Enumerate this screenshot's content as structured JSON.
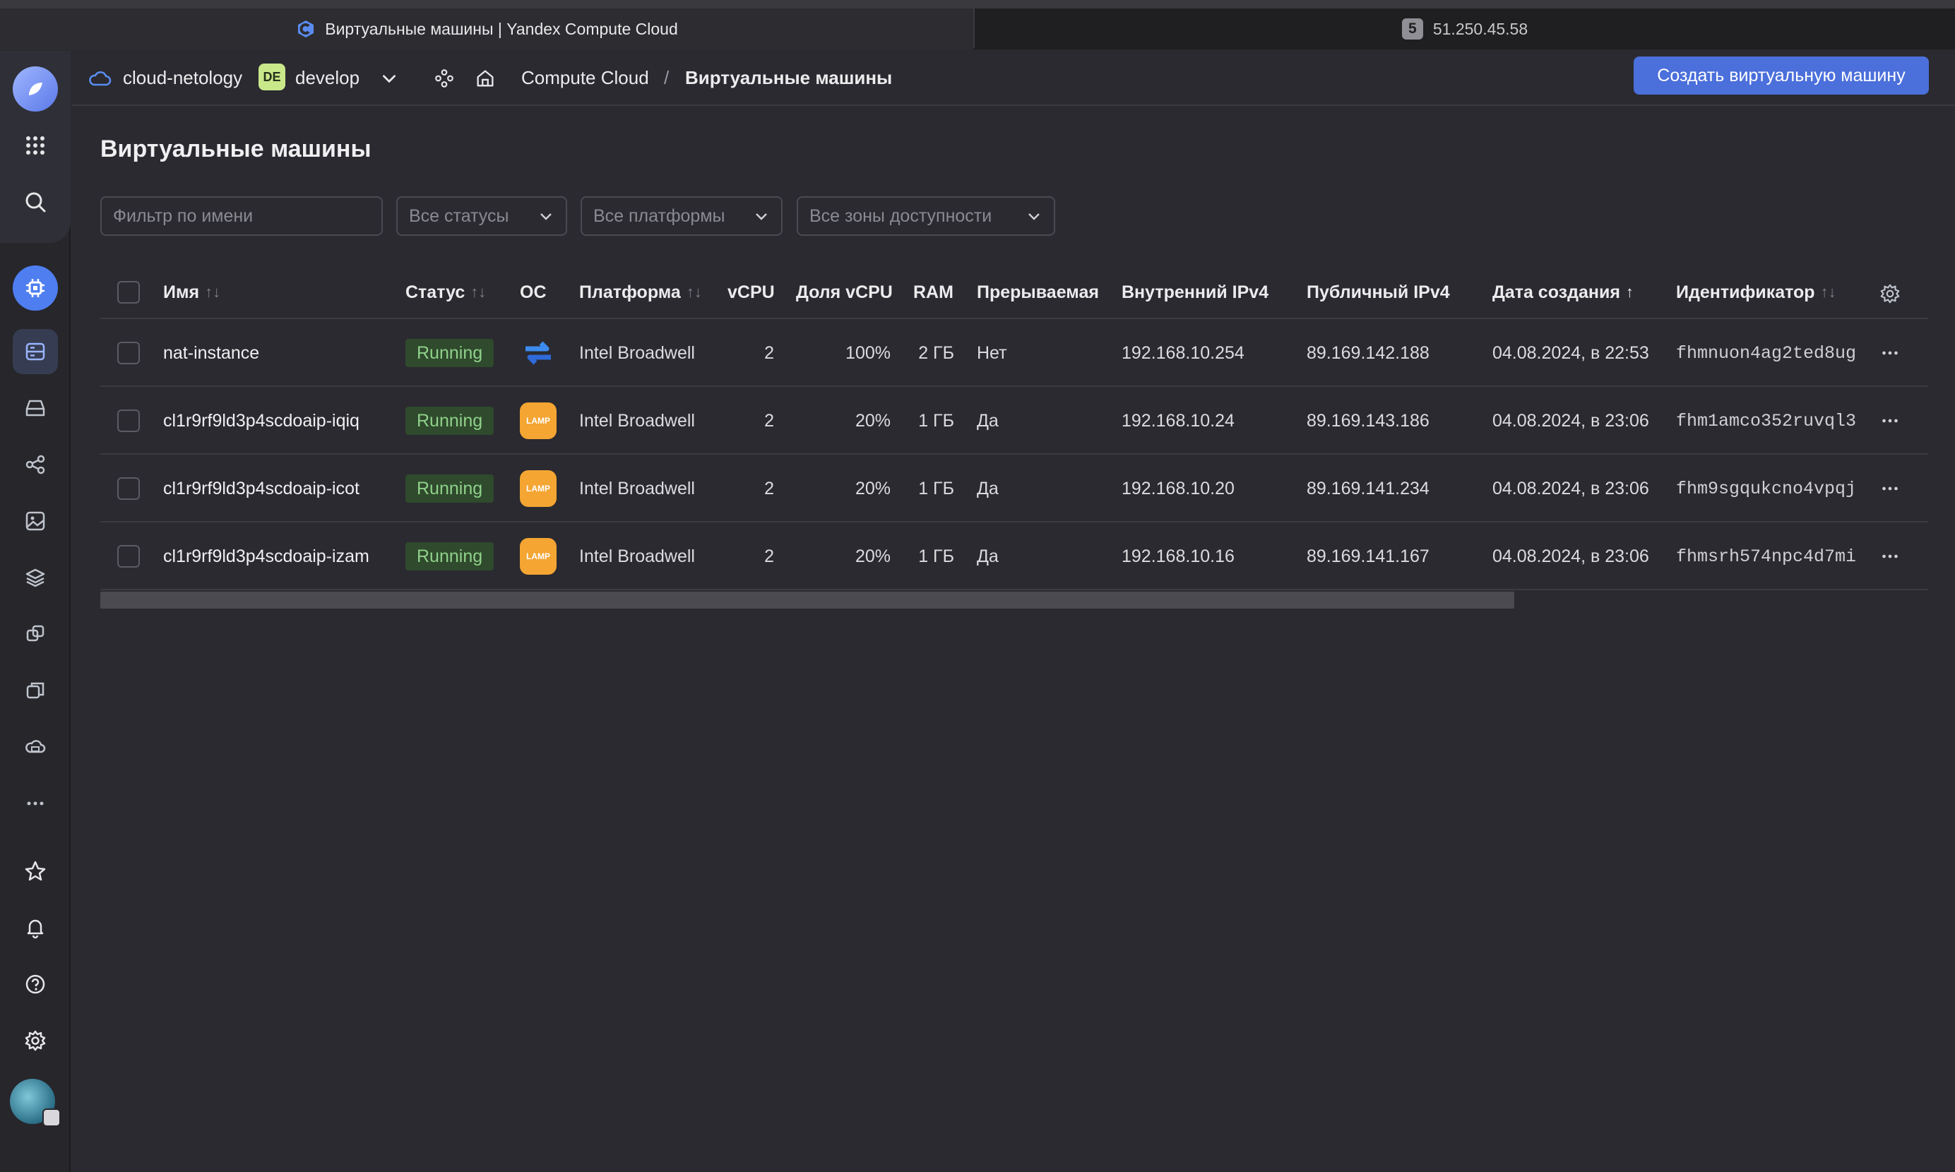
{
  "browser": {
    "active_tab_title": "Виртуальные машины | Yandex Compute Cloud",
    "inactive_tab_badge": "5",
    "inactive_tab_title": "51.250.45.58"
  },
  "header": {
    "cloud_name": "cloud-netology",
    "folder_badge": "DE",
    "folder_name": "develop",
    "breadcrumb_service": "Compute Cloud",
    "breadcrumb_separator": "/",
    "breadcrumb_current": "Виртуальные машины",
    "create_button": "Создать виртуальную машину"
  },
  "page": {
    "title": "Виртуальные машины",
    "filter_placeholder": "Фильтр по имени",
    "status_select": "Все статусы",
    "platform_select": "Все платформы",
    "zone_select": "Все зоны доступности"
  },
  "table": {
    "columns": {
      "name": "Имя",
      "status": "Статус",
      "os": "ОС",
      "platform": "Платформа",
      "vcpu": "vCPU",
      "vcpu_share": "Доля vCPU",
      "ram": "RAM",
      "preemptible": "Прерываемая",
      "internal_ip": "Внутренний IPv4",
      "public_ip": "Публичный IPv4",
      "created": "Дата создания",
      "id": "Идентификатор"
    },
    "rows": [
      {
        "name": "nat-instance",
        "status": "Running",
        "os": "nat-icon",
        "platform": "Intel Broadwell",
        "vcpu": "2",
        "vcpu_share": "100%",
        "ram": "2 ГБ",
        "preemptible": "Нет",
        "internal_ip": "192.168.10.254",
        "public_ip": "89.169.142.188",
        "created": "04.08.2024, в 22:53",
        "id": "fhmnuon4ag2ted8ug"
      },
      {
        "name": "cl1r9rf9ld3p4scdoaip-iqiq",
        "status": "Running",
        "os": "LAMP",
        "platform": "Intel Broadwell",
        "vcpu": "2",
        "vcpu_share": "20%",
        "ram": "1 ГБ",
        "preemptible": "Да",
        "internal_ip": "192.168.10.24",
        "public_ip": "89.169.143.186",
        "created": "04.08.2024, в 23:06",
        "id": "fhm1amco352ruvql3"
      },
      {
        "name": "cl1r9rf9ld3p4scdoaip-icot",
        "status": "Running",
        "os": "LAMP",
        "platform": "Intel Broadwell",
        "vcpu": "2",
        "vcpu_share": "20%",
        "ram": "1 ГБ",
        "preemptible": "Да",
        "internal_ip": "192.168.10.20",
        "public_ip": "89.169.141.234",
        "created": "04.08.2024, в 23:06",
        "id": "fhm9sgqukcno4vpqj"
      },
      {
        "name": "cl1r9rf9ld3p4scdoaip-izam",
        "status": "Running",
        "os": "LAMP",
        "platform": "Intel Broadwell",
        "vcpu": "2",
        "vcpu_share": "20%",
        "ram": "1 ГБ",
        "preemptible": "Да",
        "internal_ip": "192.168.10.16",
        "public_ip": "89.169.141.167",
        "created": "04.08.2024, в 23:06",
        "id": "fhmsrh574npc4d7mi"
      }
    ]
  },
  "colors": {
    "accent": "#4b6fdb",
    "running_bg": "#2f4a2c",
    "running_text": "#8fd18a",
    "lamp": "#f4a532"
  }
}
